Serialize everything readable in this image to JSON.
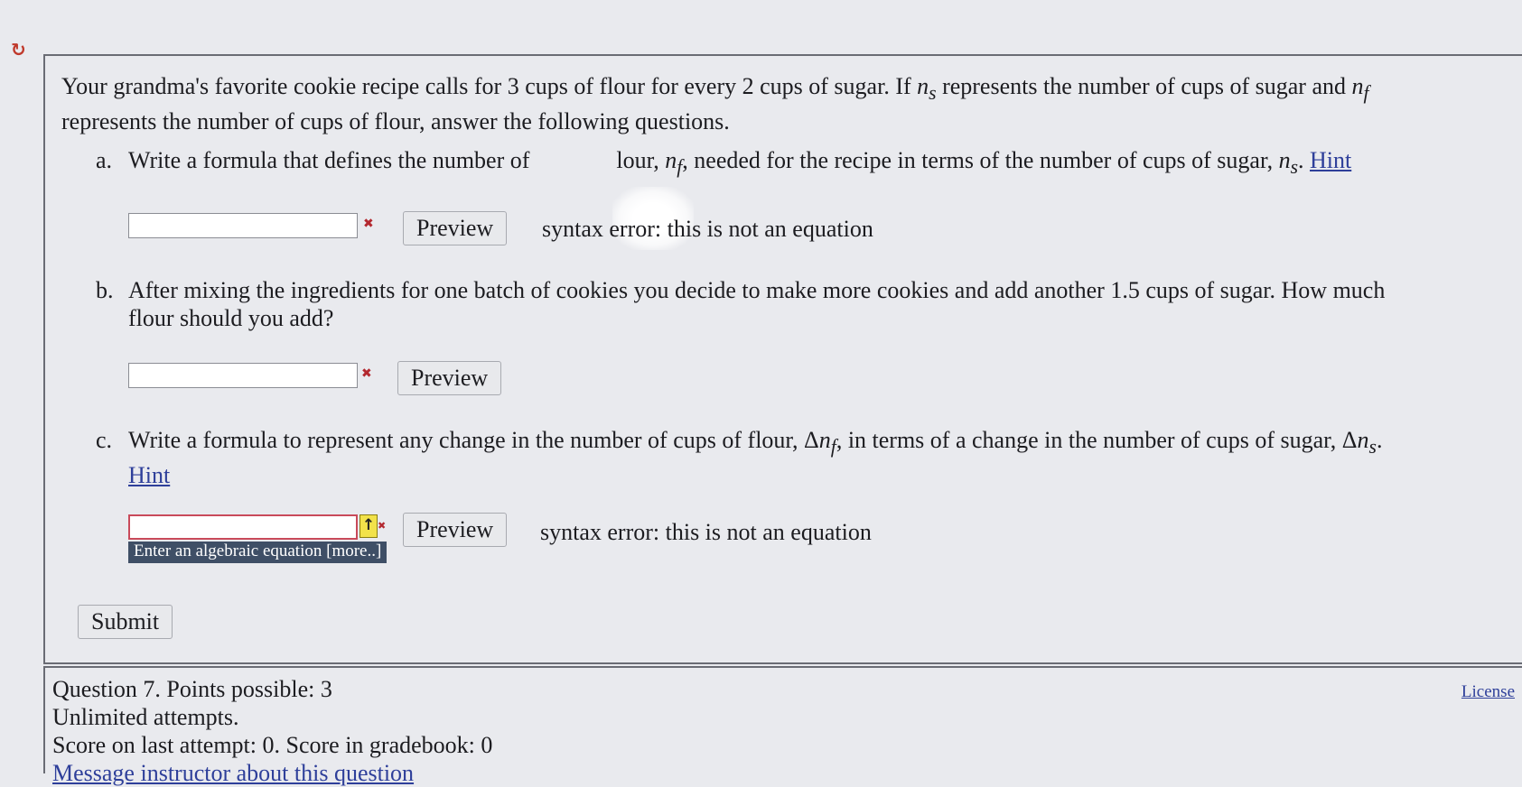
{
  "page": {
    "reload_icon": "reload-icon",
    "accent_color": "#c0392b",
    "link_color": "#2e3f9a"
  },
  "question": {
    "intro_1": "Your grandma's favorite cookie recipe calls for 3 cups of flour for every 2 cups of sugar. If ",
    "var_ns": "n",
    "sub_s": "s",
    "intro_2": " represents the number of cups of sugar and ",
    "var_nf": "n",
    "sub_f": "f",
    "intro_3": "represents the number of cups of flour, answer the following questions.",
    "parts": {
      "a": {
        "letter": "a.",
        "text_1": "Write a formula that defines the number of",
        "text_2": "lour, ",
        "text_3": ", needed for the recipe in terms of the number of cups of sugar, ",
        "text_4": ". ",
        "hint": "Hint",
        "preview": "Preview",
        "message": "syntax error: this is not an equation"
      },
      "b": {
        "letter": "b.",
        "text_line1": "After mixing the ingredients for one batch of cookies you decide to make more cookies and add another 1.5 cups of sugar. How much",
        "text_line2": "flour should you add?",
        "preview": "Preview"
      },
      "c": {
        "letter": "c.",
        "text_1": "Write a formula to represent any change in the number of cups of flour, ",
        "delta": "Δ",
        "text_2": ", in terms of a change in the number of cups of sugar, ",
        "text_3": ".",
        "hint": "Hint",
        "preview": "Preview",
        "message": "syntax error: this is not an equation",
        "tooltip": "Enter an algebraic equation [more..]",
        "arrow": "↑"
      }
    },
    "submit": "Submit"
  },
  "footer": {
    "points": "Question 7. Points possible: 3",
    "attempts": "Unlimited attempts.",
    "score": "Score on last attempt: 0. Score in gradebook: 0",
    "message_link": "Message instructor about this question",
    "license": "License"
  }
}
